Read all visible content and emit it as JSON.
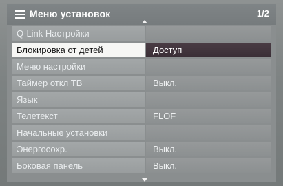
{
  "menu": {
    "title": "Меню установок",
    "page_indicator": "1/2",
    "icon": "menu-list-icon",
    "items": [
      {
        "label": "Q-Link Настройки",
        "value": ""
      },
      {
        "label": "Блокировка от детей",
        "value": "Доступ",
        "selected": true
      },
      {
        "label": "Меню настройки",
        "value": ""
      },
      {
        "label": "Таймер откл ТВ",
        "value": "Выкл."
      },
      {
        "label": "Язык",
        "value": ""
      },
      {
        "label": "Телетекст",
        "value": "FLOF"
      },
      {
        "label": "Начальные установки",
        "value": ""
      },
      {
        "label": "Энергосохр.",
        "value": "Выкл."
      },
      {
        "label": "Боковая панель",
        "value": "Выкл."
      }
    ]
  },
  "colors": {
    "selected_label_bg": "#f6f6f4",
    "selected_value_bg": "#3a2e36",
    "row_label_bg": "#a3a7a8",
    "row_value_bg": "#8c9091",
    "header_bg": "#7b8082"
  }
}
